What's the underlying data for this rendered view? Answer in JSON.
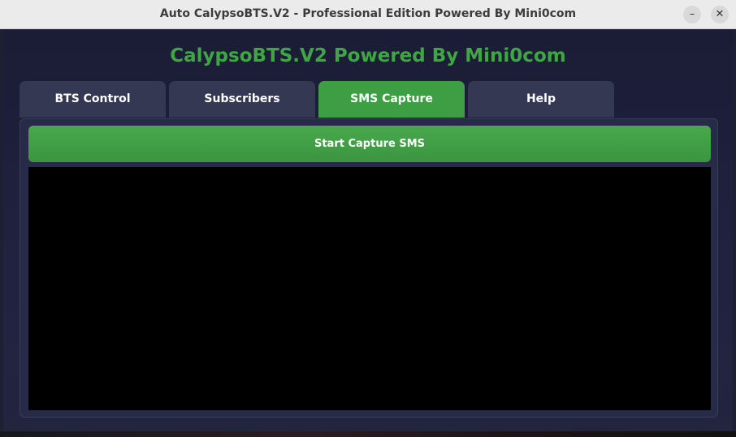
{
  "window": {
    "title": "Auto CalypsoBTS.V2 - Professional Edition Powered By Mini0com",
    "minimize_glyph": "–",
    "close_glyph": "✕"
  },
  "app": {
    "header": "CalypsoBTS.V2 Powered By Mini0com",
    "accent_color": "#3fa644"
  },
  "tabs": [
    {
      "label": "BTS Control",
      "active": false
    },
    {
      "label": "Subscribers",
      "active": false
    },
    {
      "label": "SMS Capture",
      "active": true
    },
    {
      "label": "Help",
      "active": false
    }
  ],
  "sms_capture": {
    "start_button_label": "Start Capture SMS",
    "log_text": ""
  },
  "icons": {
    "minimize": "minimize-icon",
    "close": "close-icon"
  }
}
